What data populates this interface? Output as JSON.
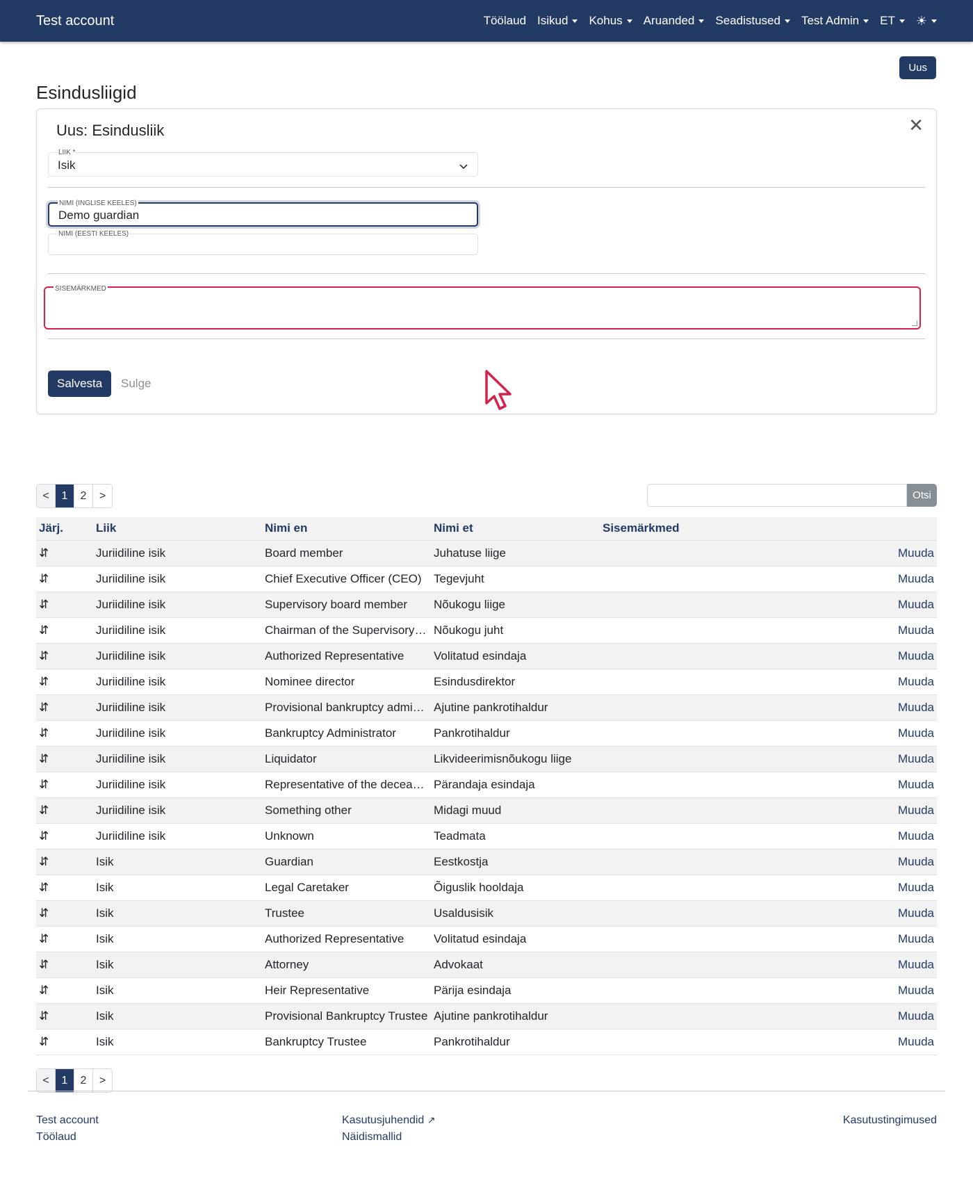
{
  "app": {
    "title": "Test account"
  },
  "nav": {
    "items": [
      {
        "label": "Töölaud",
        "dropdown": false
      },
      {
        "label": "Isikud",
        "dropdown": true
      },
      {
        "label": "Kohus",
        "dropdown": true
      },
      {
        "label": "Aruanded",
        "dropdown": true
      },
      {
        "label": "Seadistused",
        "dropdown": true
      },
      {
        "label": "Test Admin",
        "dropdown": true
      },
      {
        "label": "ET",
        "dropdown": true
      }
    ],
    "theme_icon": "☀"
  },
  "page": {
    "title": "Esindusliigid",
    "new_button": "Uus"
  },
  "form": {
    "title": "Uus: Esindusliik",
    "type_label": "Liik *",
    "type_value": "Isik",
    "name_en_label": "Nimi (inglise keeles)",
    "name_en_value": "Demo guardian",
    "name_et_label": "Nimi (eesti keeles)",
    "name_et_value": "",
    "notes_label": "Sisemärkmed",
    "notes_value": "",
    "save": "Salvesta",
    "close": "Sulge"
  },
  "pagination": {
    "prev": "<",
    "pages": [
      "1",
      "2"
    ],
    "current": "1",
    "next": ">"
  },
  "search": {
    "value": "",
    "button": "Otsi"
  },
  "table": {
    "headers": [
      "Järj.",
      "Liik",
      "Nimi en",
      "Nimi et",
      "Sisemärkmed"
    ],
    "edit_label": "Muuda",
    "rows": [
      {
        "type": "Juriidiline isik",
        "name_en": "Board member",
        "name_et": "Juhatuse liige",
        "notes": ""
      },
      {
        "type": "Juriidiline isik",
        "name_en": "Chief Executive Officer (CEO)",
        "name_et": "Tegevjuht",
        "notes": ""
      },
      {
        "type": "Juriidiline isik",
        "name_en": "Supervisory board member",
        "name_et": "Nõukogu liige",
        "notes": ""
      },
      {
        "type": "Juriidiline isik",
        "name_en": "Chairman of the Supervisory B…",
        "name_et": "Nõukogu juht",
        "notes": ""
      },
      {
        "type": "Juriidiline isik",
        "name_en": "Authorized Representative",
        "name_et": "Volitatud esindaja",
        "notes": ""
      },
      {
        "type": "Juriidiline isik",
        "name_en": "Nominee director",
        "name_et": "Esindusdirektor",
        "notes": ""
      },
      {
        "type": "Juriidiline isik",
        "name_en": "Provisional bankruptcy admini…",
        "name_et": "Ajutine pankrotihaldur",
        "notes": ""
      },
      {
        "type": "Juriidiline isik",
        "name_en": "Bankruptcy Administrator",
        "name_et": "Pankrotihaldur",
        "notes": ""
      },
      {
        "type": "Juriidiline isik",
        "name_en": "Liquidator",
        "name_et": "Likvideerimisnõukogu liige",
        "notes": ""
      },
      {
        "type": "Juriidiline isik",
        "name_en": "Representative of the deceased",
        "name_et": "Pärandaja esindaja",
        "notes": ""
      },
      {
        "type": "Juriidiline isik",
        "name_en": "Something other",
        "name_et": "Midagi muud",
        "notes": ""
      },
      {
        "type": "Juriidiline isik",
        "name_en": "Unknown",
        "name_et": "Teadmata",
        "notes": ""
      },
      {
        "type": "Isik",
        "name_en": "Guardian",
        "name_et": "Eestkostja",
        "notes": ""
      },
      {
        "type": "Isik",
        "name_en": "Legal Caretaker",
        "name_et": "Õiguslik hooldaja",
        "notes": ""
      },
      {
        "type": "Isik",
        "name_en": "Trustee",
        "name_et": "Usaldusisik",
        "notes": ""
      },
      {
        "type": "Isik",
        "name_en": "Authorized Representative",
        "name_et": "Volitatud esindaja",
        "notes": ""
      },
      {
        "type": "Isik",
        "name_en": "Attorney",
        "name_et": "Advokaat",
        "notes": ""
      },
      {
        "type": "Isik",
        "name_en": "Heir Representative",
        "name_et": "Pärija esindaja",
        "notes": ""
      },
      {
        "type": "Isik",
        "name_en": "Provisional Bankruptcy Trustee",
        "name_et": "Ajutine pankrotihaldur",
        "notes": ""
      },
      {
        "type": "Isik",
        "name_en": "Bankruptcy Trustee",
        "name_et": "Pankrotihaldur",
        "notes": ""
      }
    ]
  },
  "footer": {
    "links_left": [
      "Test account",
      "Töölaud"
    ],
    "links_mid": [
      "Kasutusjuhendid",
      "Näidismallid"
    ],
    "link_right": "Kasutustingimused"
  },
  "colors": {
    "primary": "#233a64",
    "error": "#d6214a",
    "muted": "#868e96"
  }
}
